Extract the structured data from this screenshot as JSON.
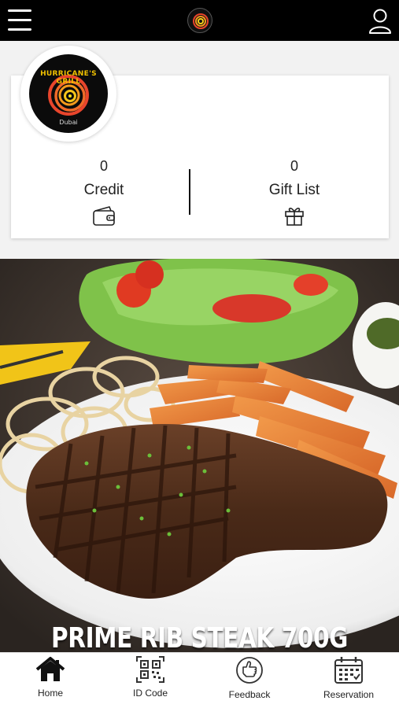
{
  "header": {
    "menu_icon": "hamburger-menu-icon",
    "logo_icon": "hurricanes-grill-logo",
    "profile_icon": "user-profile-icon"
  },
  "profile_card": {
    "brand_name": "HURRICANE'S GRILL",
    "brand_city": "Dubai",
    "credit": {
      "value": "0",
      "label": "Credit",
      "icon": "wallet-icon"
    },
    "gift_list": {
      "value": "0",
      "label": "Gift List",
      "icon": "gift-icon"
    }
  },
  "hero": {
    "caption": "PRIME RIB STEAK 700G"
  },
  "bottom_nav": {
    "items": [
      {
        "label": "Home",
        "icon": "home-icon"
      },
      {
        "label": "ID Code",
        "icon": "qr-code-icon"
      },
      {
        "label": "Feedback",
        "icon": "feedback-hand-icon"
      },
      {
        "label": "Reservation",
        "icon": "calendar-icon"
      }
    ]
  },
  "colors": {
    "topbar": "#000000",
    "background": "#f2f2f2",
    "brand_yellow": "#f0c000"
  }
}
